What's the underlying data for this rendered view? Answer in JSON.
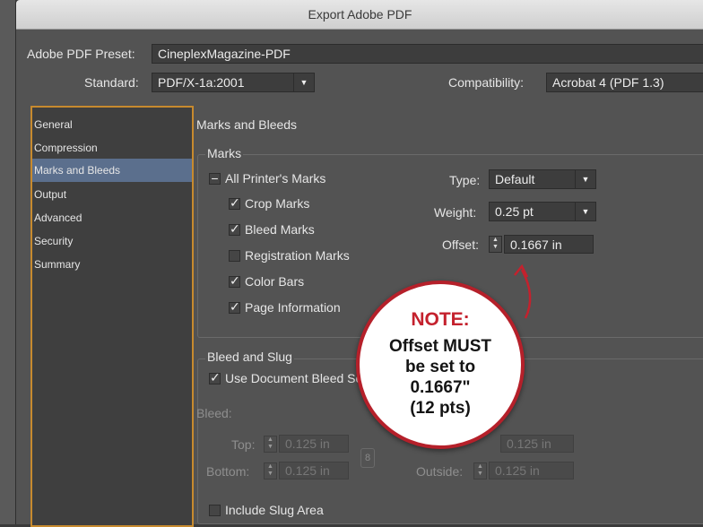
{
  "window": {
    "title": "Export Adobe PDF"
  },
  "preset": {
    "label": "Adobe PDF Preset:",
    "value": "CineplexMagazine-PDF"
  },
  "standard": {
    "label": "Standard:",
    "value": "PDF/X-1a:2001"
  },
  "compatibility": {
    "label": "Compatibility:",
    "value": "Acrobat 4 (PDF 1.3)"
  },
  "sidebar": {
    "items": [
      {
        "label": "General"
      },
      {
        "label": "Compression"
      },
      {
        "label": "Marks and Bleeds"
      },
      {
        "label": "Output"
      },
      {
        "label": "Advanced"
      },
      {
        "label": "Security"
      },
      {
        "label": "Summary"
      }
    ],
    "selected": "Marks and Bleeds"
  },
  "section": {
    "title": "Marks and Bleeds"
  },
  "marks": {
    "title": "Marks",
    "all_printers": "All Printer's Marks",
    "crop": "Crop Marks",
    "bleed": "Bleed Marks",
    "registration": "Registration Marks",
    "color_bars": "Color Bars",
    "page_info": "Page Information",
    "type_label": "Type:",
    "type_value": "Default",
    "weight_label": "Weight:",
    "weight_value": "0.25 pt",
    "offset_label": "Offset:",
    "offset_value": "0.1667 in"
  },
  "bleed": {
    "title": "Bleed and Slug",
    "use_doc": "Use Document Bleed Settings",
    "bleed_label": "Bleed:",
    "top_label": "Top:",
    "top_value": "0.125 in",
    "bottom_label": "Bottom:",
    "bottom_value": "0.125 in",
    "inside_value": "0.125 in",
    "outside_label": "Outside:",
    "outside_value": "0.125 in",
    "slug": "Include Slug Area"
  },
  "note": {
    "title": "NOTE:",
    "body": "Offset MUST\nbe set to\n0.1667\"\n(12 pts)"
  },
  "colors": {
    "accent_border": "#c78a2e",
    "selection": "#5b6f8d",
    "note_red": "#c4212d"
  }
}
